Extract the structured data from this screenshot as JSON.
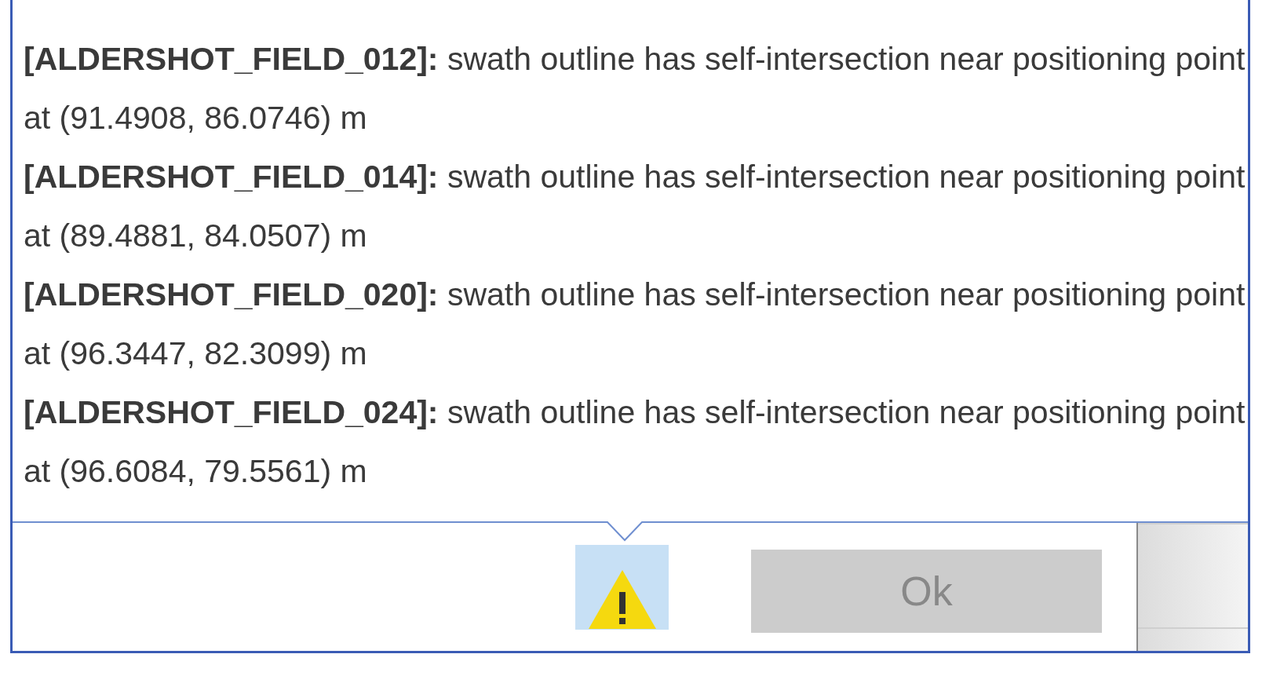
{
  "messages": [
    {
      "text": "**[ALDERSHOT_FIELD_012]:** swath outline has self-intersection near positioning point at (91.4908, 86.0746) m"
    },
    {
      "text": "**[ALDERSHOT_FIELD_014]:** swath outline has self-intersection near positioning point at (89.4881, 84.0507) m"
    },
    {
      "text": "**[ALDERSHOT_FIELD_020]:** swath outline has self-intersection near positioning point at (96.3447, 82.3099) m"
    },
    {
      "text": "**[ALDERSHOT_FIELD_024]:** swath outline has self-intersection near positioning point at (96.6084, 79.5561) m"
    }
  ],
  "ok_button": {
    "label": "Ok",
    "disabled": true
  }
}
